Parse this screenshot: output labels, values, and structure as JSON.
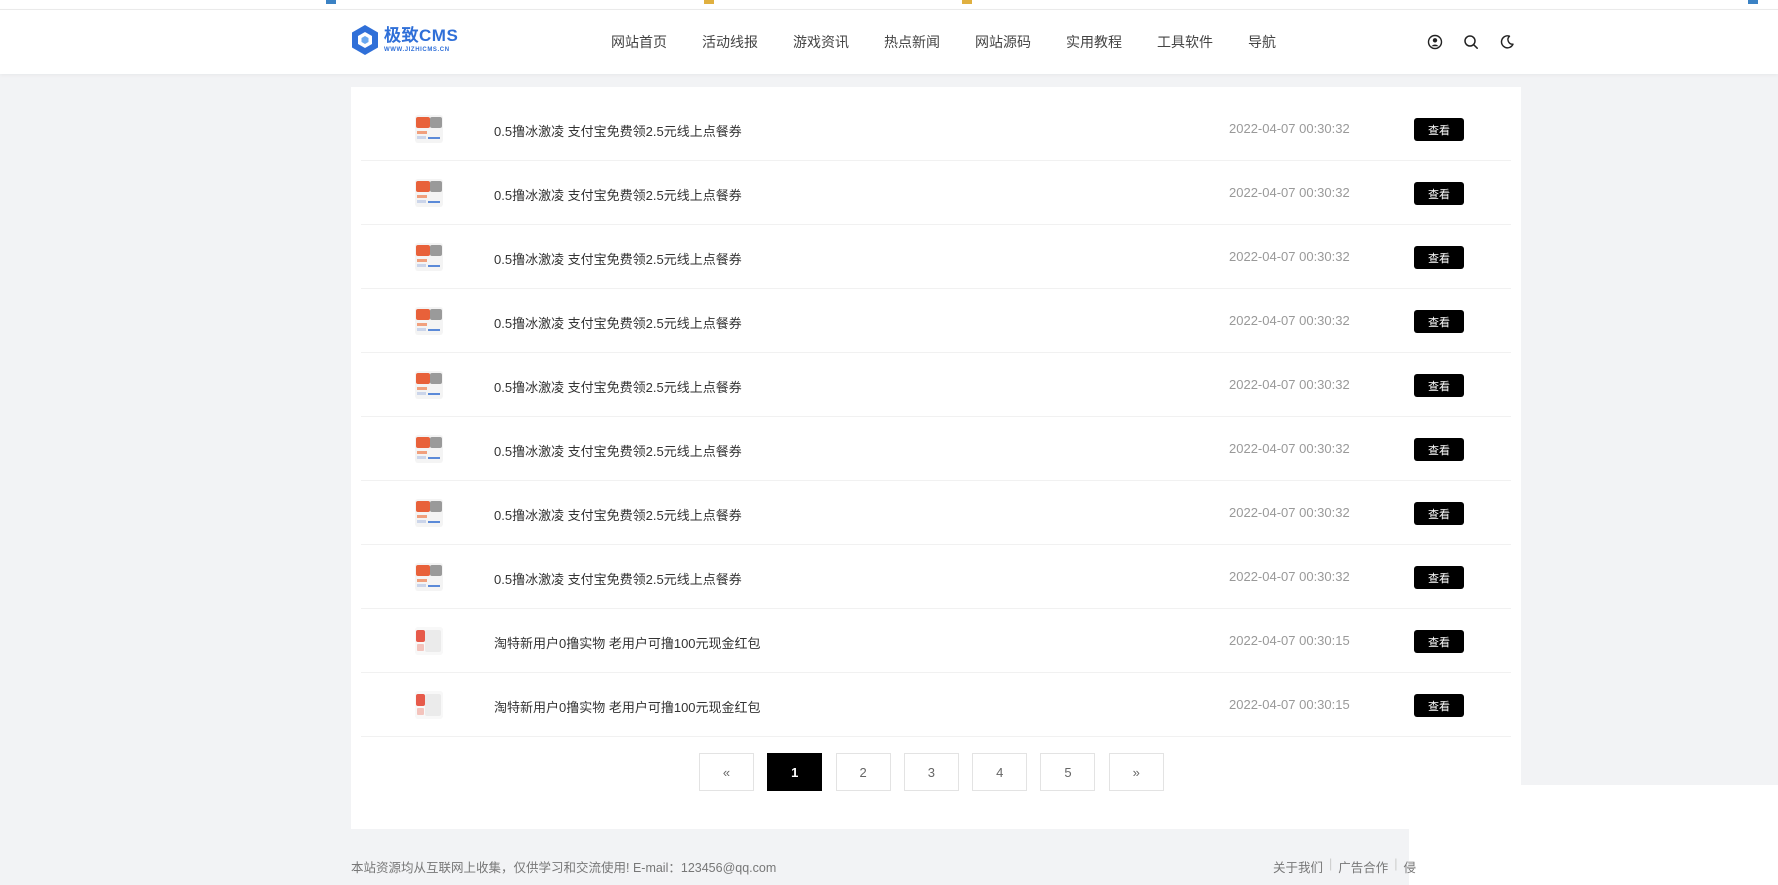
{
  "logo": {
    "brand": "极致CMS",
    "url": "WWW.JIZHICMS.CN"
  },
  "nav": [
    "网站首页",
    "活动线报",
    "游戏资讯",
    "热点新闻",
    "网站源码",
    "实用教程",
    "工具软件",
    "导航"
  ],
  "header_icons": [
    "user-icon",
    "search-icon",
    "moon-icon"
  ],
  "list": [
    {
      "title": "0.5撸冰激凌 支付宝免费领2.5元线上点餐券",
      "date": "2022-04-07 00:30:32",
      "button": "查看",
      "thumb": "orange"
    },
    {
      "title": "0.5撸冰激凌 支付宝免费领2.5元线上点餐券",
      "date": "2022-04-07 00:30:32",
      "button": "查看",
      "thumb": "orange"
    },
    {
      "title": "0.5撸冰激凌 支付宝免费领2.5元线上点餐券",
      "date": "2022-04-07 00:30:32",
      "button": "查看",
      "thumb": "orange"
    },
    {
      "title": "0.5撸冰激凌 支付宝免费领2.5元线上点餐券",
      "date": "2022-04-07 00:30:32",
      "button": "查看",
      "thumb": "orange"
    },
    {
      "title": "0.5撸冰激凌 支付宝免费领2.5元线上点餐券",
      "date": "2022-04-07 00:30:32",
      "button": "查看",
      "thumb": "orange"
    },
    {
      "title": "0.5撸冰激凌 支付宝免费领2.5元线上点餐券",
      "date": "2022-04-07 00:30:32",
      "button": "查看",
      "thumb": "orange"
    },
    {
      "title": "0.5撸冰激凌 支付宝免费领2.5元线上点餐券",
      "date": "2022-04-07 00:30:32",
      "button": "查看",
      "thumb": "orange"
    },
    {
      "title": "0.5撸冰激凌 支付宝免费领2.5元线上点餐券",
      "date": "2022-04-07 00:30:32",
      "button": "查看",
      "thumb": "orange"
    },
    {
      "title": "淘特新用户0撸实物 老用户可撸100元现金红包",
      "date": "2022-04-07 00:30:15",
      "button": "查看",
      "thumb": "red"
    },
    {
      "title": "淘特新用户0撸实物 老用户可撸100元现金红包",
      "date": "2022-04-07 00:30:15",
      "button": "查看",
      "thumb": "red"
    }
  ],
  "pagination": {
    "prev": "«",
    "pages": [
      "1",
      "2",
      "3",
      "4",
      "5"
    ],
    "current": "1",
    "next": "»"
  },
  "footer": {
    "notice": "本站资源均从互联网上收集，仅供学习和交流使用! E-mail：123456@qq.com",
    "links": [
      "关于我们",
      "广告合作",
      "侵"
    ]
  },
  "colors": {
    "brand": "#2f6fd8",
    "button": "#000000",
    "page_bg": "#f2f3f5"
  }
}
